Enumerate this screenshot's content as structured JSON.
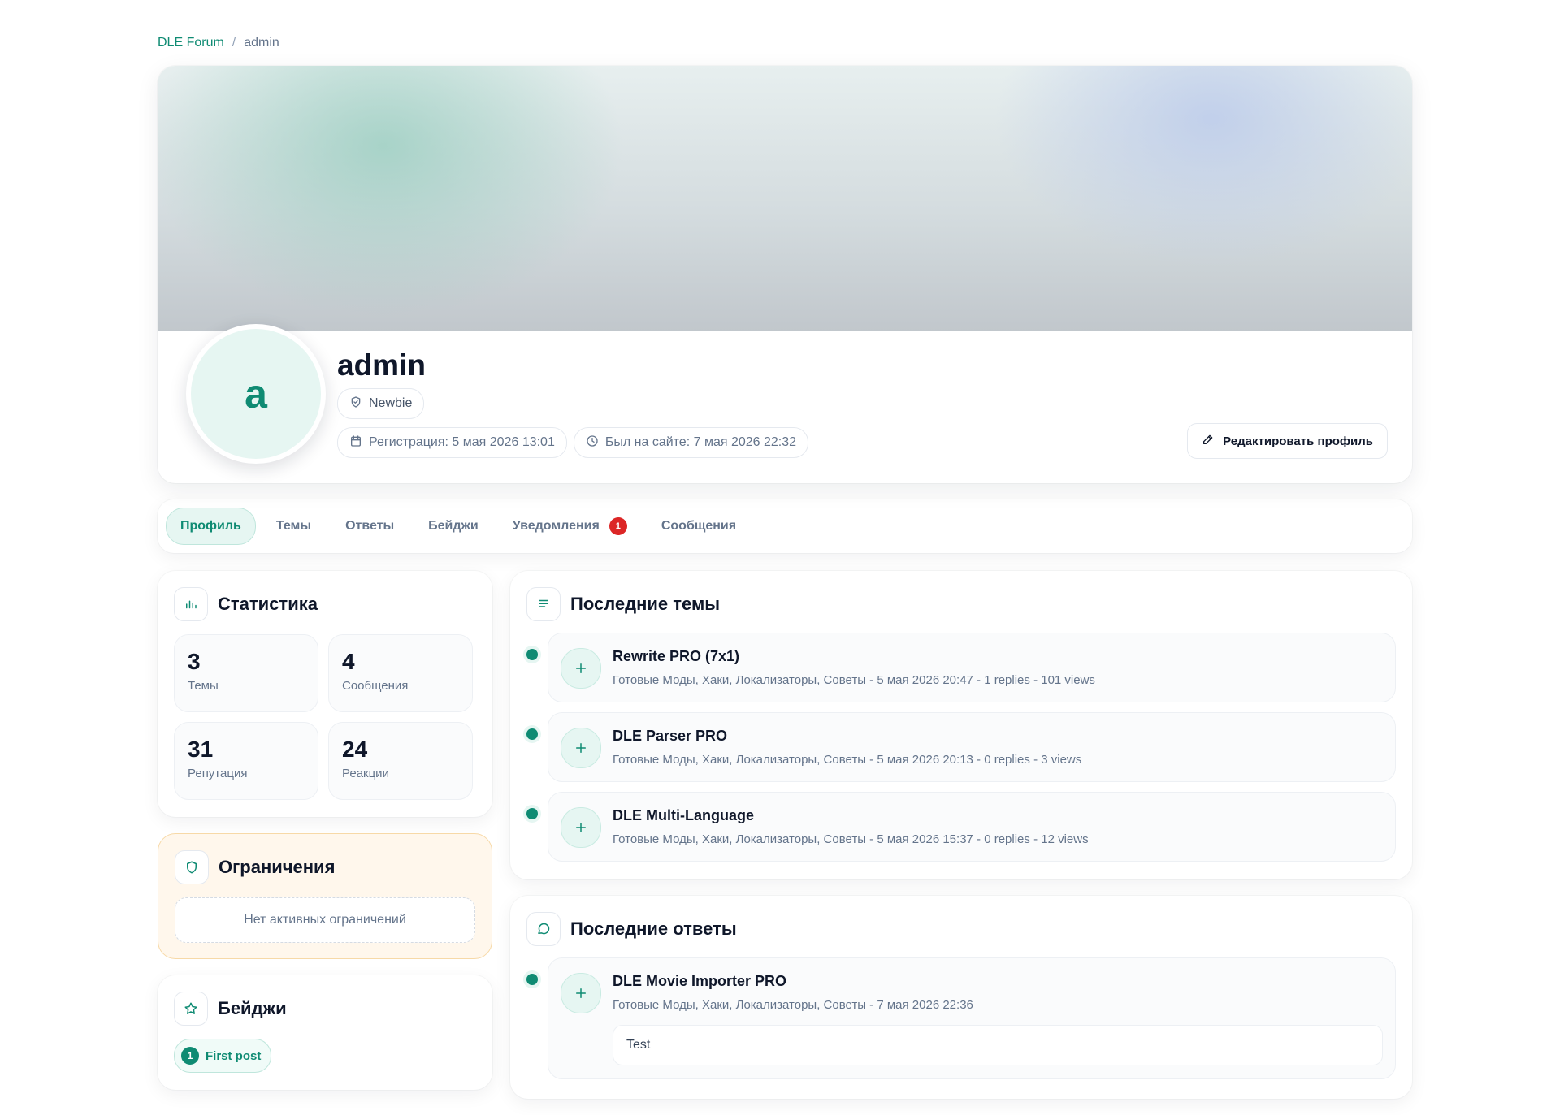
{
  "breadcrumb": {
    "home": "DLE Forum",
    "separator": "/",
    "current": "admin"
  },
  "profile": {
    "avatar_letter": "a",
    "username": "admin",
    "rank": "Newbie",
    "registered": "Регистрация: 5 мая 2026 13:01",
    "last_seen": "Был на сайте: 7 мая 2026 22:32",
    "edit_label": "Редактировать профиль"
  },
  "tabs": [
    {
      "label": "Профиль",
      "active": true
    },
    {
      "label": "Темы"
    },
    {
      "label": "Ответы"
    },
    {
      "label": "Бейджи"
    },
    {
      "label": "Уведомления",
      "badge": "1"
    },
    {
      "label": "Сообщения"
    }
  ],
  "stats": {
    "title": "Статистика",
    "items": [
      {
        "value": "3",
        "label": "Темы"
      },
      {
        "value": "4",
        "label": "Сообщения"
      },
      {
        "value": "31",
        "label": "Репутация"
      },
      {
        "value": "24",
        "label": "Реакции"
      }
    ]
  },
  "restrictions": {
    "title": "Ограничения",
    "empty": "Нет активных ограничений"
  },
  "badges": {
    "title": "Бейджи",
    "items": [
      {
        "num": "1",
        "label": "First post"
      }
    ]
  },
  "latest_topics": {
    "title": "Последние темы",
    "items": [
      {
        "title": "Rewrite PRO (7x1)",
        "meta": "Готовые Моды, Хаки, Локализаторы, Советы - 5 мая 2026 20:47 - 1 replies - 101 views"
      },
      {
        "title": "DLE Parser PRO",
        "meta": "Готовые Моды, Хаки, Локализаторы, Советы - 5 мая 2026 20:13 - 0 replies - 3 views"
      },
      {
        "title": "DLE Multi-Language",
        "meta": "Готовые Моды, Хаки, Локализаторы, Советы - 5 мая 2026 15:37 - 0 replies - 12 views"
      }
    ]
  },
  "latest_replies": {
    "title": "Последние ответы",
    "items": [
      {
        "title": "DLE Movie Importer PRO",
        "meta": "Готовые Моды, Хаки, Локализаторы, Советы - 7 мая 2026 22:36",
        "text": "Test"
      }
    ]
  },
  "colors": {
    "accent": "#0f8b73",
    "accent_soft": "#e6f6f2",
    "danger": "#dc2626",
    "warning_bg": "#fff7ec"
  }
}
